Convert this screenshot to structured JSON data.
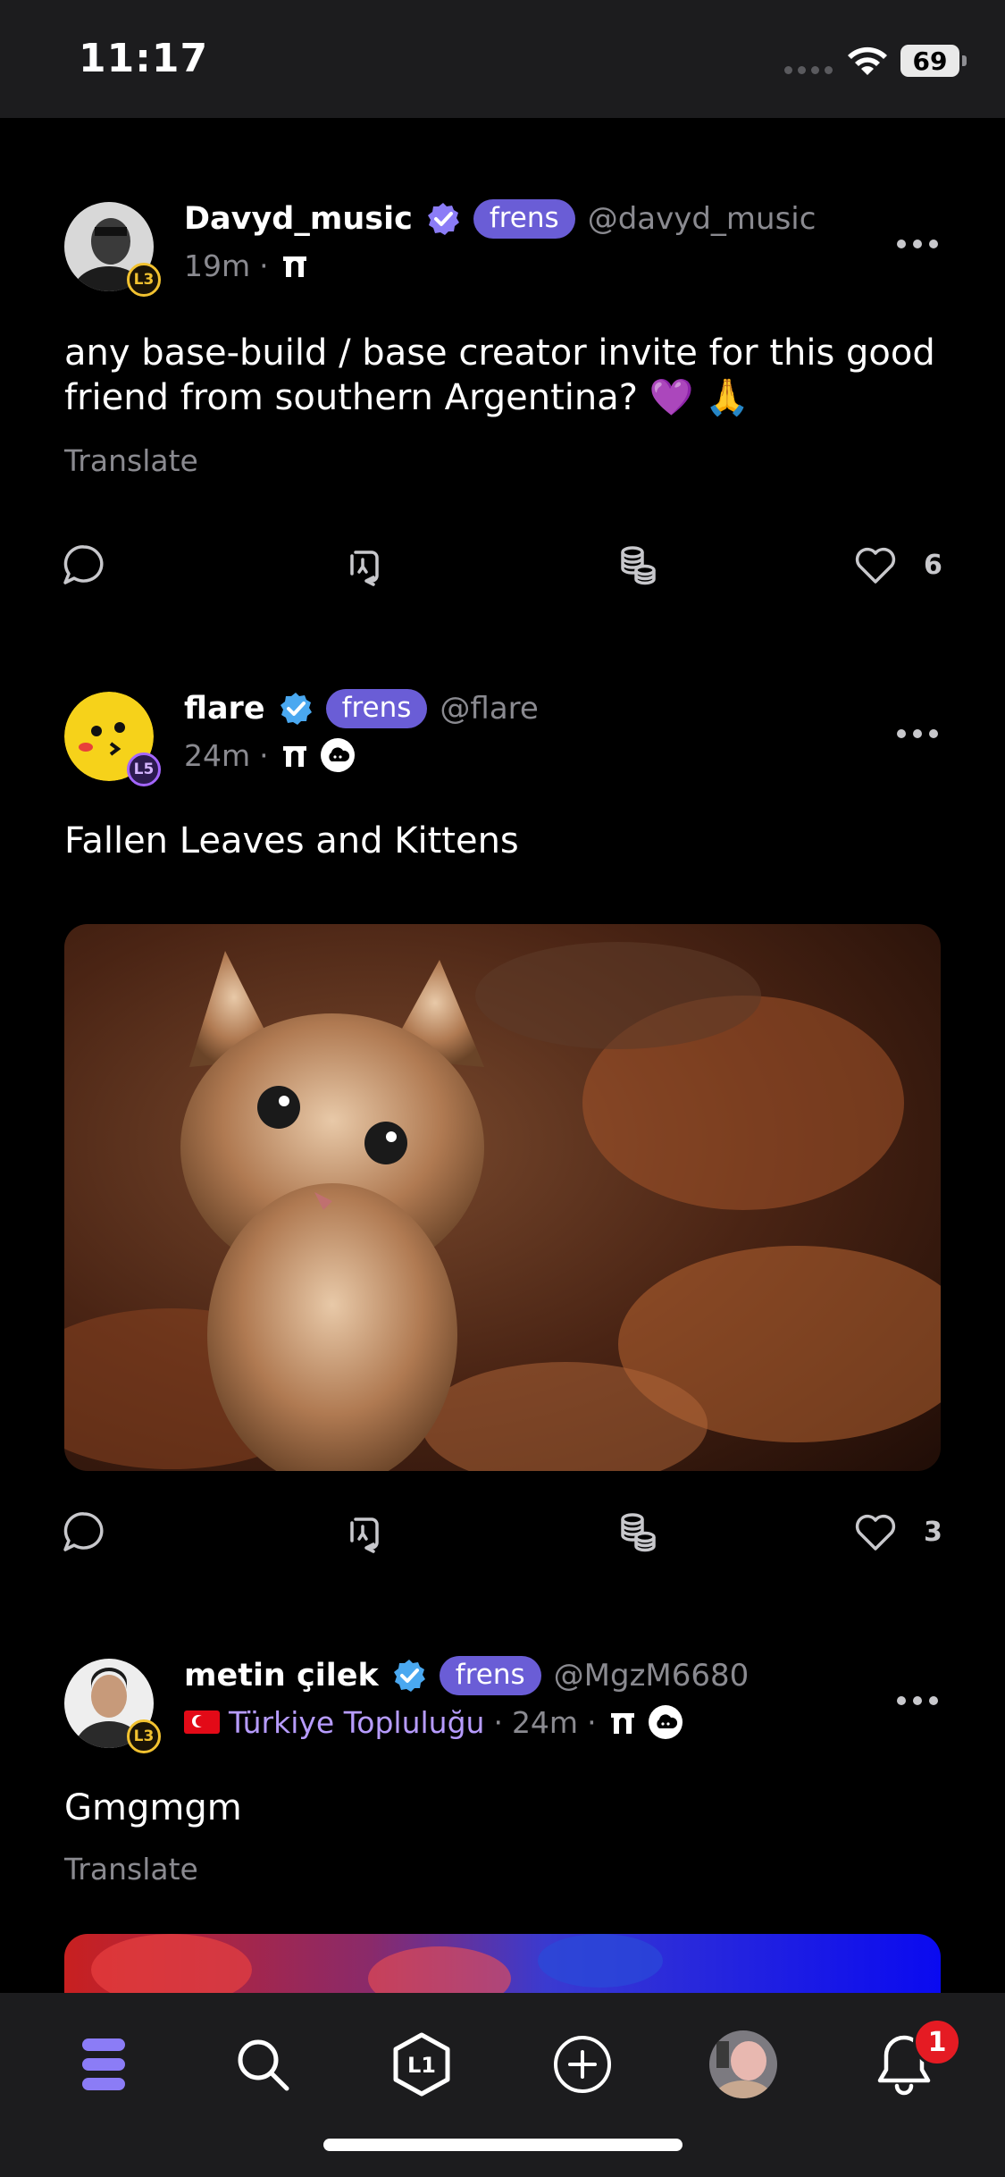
{
  "status_bar": {
    "time": "11:17",
    "battery": "69"
  },
  "posts": [
    {
      "display_name": "Davyd_music",
      "badge": "frens",
      "handle": "@davyd_music",
      "level": "L3",
      "time": "19m",
      "separator": "·",
      "text": "any base-build / base creator invite for this good friend from southern Argentina? 💜 🙏",
      "translate": "Translate",
      "likes": "6"
    },
    {
      "display_name": "flare",
      "badge": "frens",
      "handle": "@flare",
      "level": "L5",
      "time": "24m",
      "separator": "·",
      "text": "Fallen Leaves and Kittens",
      "likes": "3"
    },
    {
      "display_name": "metin çilek",
      "badge": "frens",
      "handle": "@MgzM6680",
      "level": "L3",
      "community": "Türkiye Topluluğu",
      "time": "24m",
      "separator": "·",
      "text": "Gmgmgm",
      "translate": "Translate"
    }
  ],
  "bottom_nav": {
    "items": [
      "home-icon",
      "search-icon",
      "l1-hexagon-icon",
      "compose-plus-icon",
      "profile-avatar",
      "bell-icon"
    ],
    "notification_count": "1",
    "hexagon_label": "L1"
  },
  "colors": {
    "accent": "#6a5dd6",
    "verified": "#8b7cf6",
    "notification": "#e51b23"
  }
}
